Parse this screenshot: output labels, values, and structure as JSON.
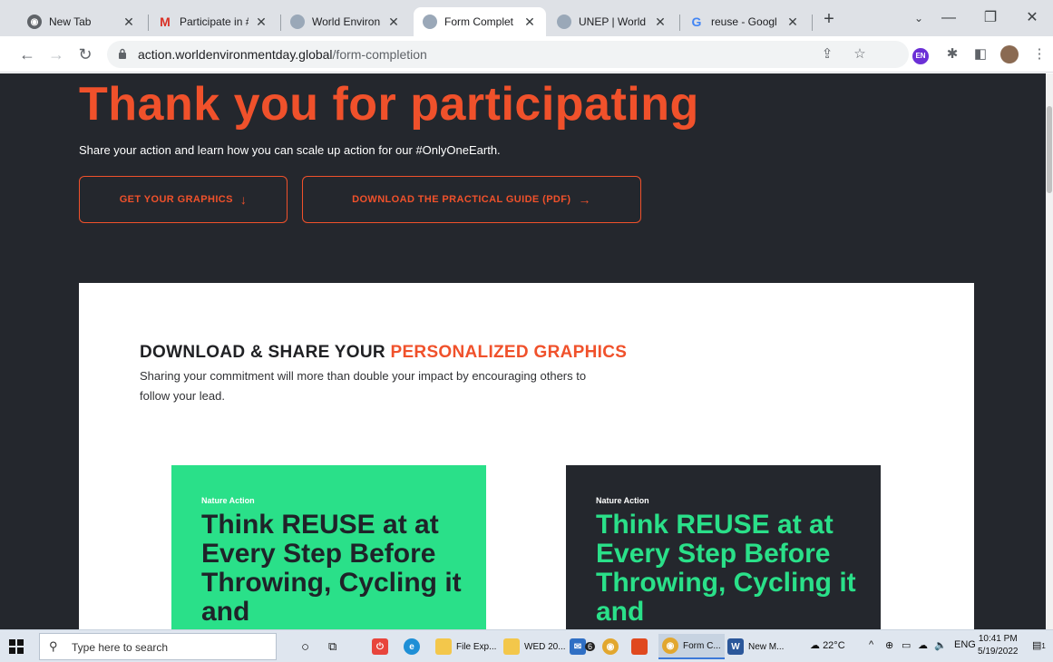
{
  "browser": {
    "tabs": [
      {
        "title": "New Tab",
        "icon": "chrome-icon",
        "active": false
      },
      {
        "title": "Participate in #",
        "icon": "gmail-icon",
        "active": false
      },
      {
        "title": "World Environ",
        "icon": "wed-globe-icon",
        "active": false
      },
      {
        "title": "Form Complet",
        "icon": "wed-globe-icon",
        "active": true
      },
      {
        "title": "UNEP | World",
        "icon": "wed-globe-icon",
        "active": false
      },
      {
        "title": "reuse - Googl",
        "icon": "google-icon",
        "active": false
      }
    ],
    "address": {
      "domain": "action.worldenvironmentday.global",
      "path": "/form-completion"
    },
    "profile_badge": "EN"
  },
  "page": {
    "hero_title": "Thank you for participating",
    "hero_subtitle": "Share your action and learn how you can scale up action for our #OnlyOneEarth.",
    "buttons": {
      "graphics": "GET YOUR GRAPHICS",
      "guide": "DOWNLOAD THE PRACTICAL GUIDE (PDF)"
    },
    "section": {
      "heading_main": "DOWNLOAD & SHARE YOUR ",
      "heading_accent": "PERSONALIZED GRAPHICS",
      "body": "Sharing your commitment will more than double your impact by encouraging others to follow your lead."
    },
    "graphics": [
      {
        "kicker": "Nature Action",
        "text": "Think REUSE at at Every Step Before Throwing, Cycling it and"
      },
      {
        "kicker": "Nature Action",
        "text": "Think REUSE at at Every Step Before Throwing, Cycling it and"
      }
    ],
    "colors": {
      "accent": "#f0512b",
      "green": "#2ae089",
      "dark": "#24272d"
    }
  },
  "taskbar": {
    "search_placeholder": "Type here to search",
    "apps": [
      {
        "label": "File Exp...",
        "icon": "folder-icon"
      },
      {
        "label": "WED 20...",
        "icon": "folder-icon"
      },
      {
        "label": "Form C...",
        "icon": "chrome-icon"
      },
      {
        "label": "New M...",
        "icon": "word-icon"
      }
    ],
    "mail_badge": "6",
    "weather": "22°C",
    "language": "ENG",
    "time": "10:41 PM",
    "date": "5/19/2022",
    "notification_badge": "1"
  }
}
